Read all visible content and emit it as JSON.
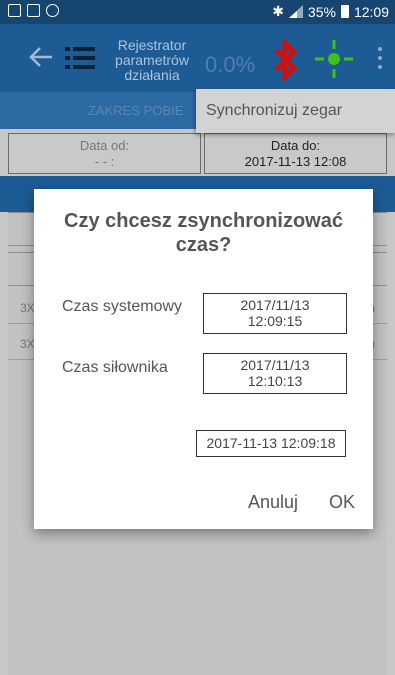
{
  "status_bar": {
    "battery": "35%",
    "time": "12:09"
  },
  "app_bar": {
    "title": "Rejestrator parametrów działania",
    "progress": "0.0%",
    "colors": {
      "bluetooth": "#cc1111",
      "gps": "#3ec21a"
    }
  },
  "range_bar": {
    "label": "ZAKRES POBIE"
  },
  "overflow_menu": {
    "item": "Synchronizuj zegar"
  },
  "dates": {
    "from_label": "Data od:",
    "from_value": "- - :",
    "to_label": "Data do:",
    "to_value": "2017-11-13 12:08"
  },
  "list": [
    {
      "left": "3X",
      "right": "m"
    },
    {
      "left": "3X",
      "right": "m"
    }
  ],
  "dialog": {
    "title": "Czy chcesz zsynchronizować czas?",
    "system_label": "Czas systemowy",
    "system_date": "2017/11/13",
    "system_time": "12:09:15",
    "actuator_label": "Czas siłownika",
    "actuator_date": "2017/11/13",
    "actuator_time": "12:10:13",
    "timestamp": "2017-11-13 12:09:18",
    "cancel": "Anuluj",
    "ok": "OK"
  }
}
